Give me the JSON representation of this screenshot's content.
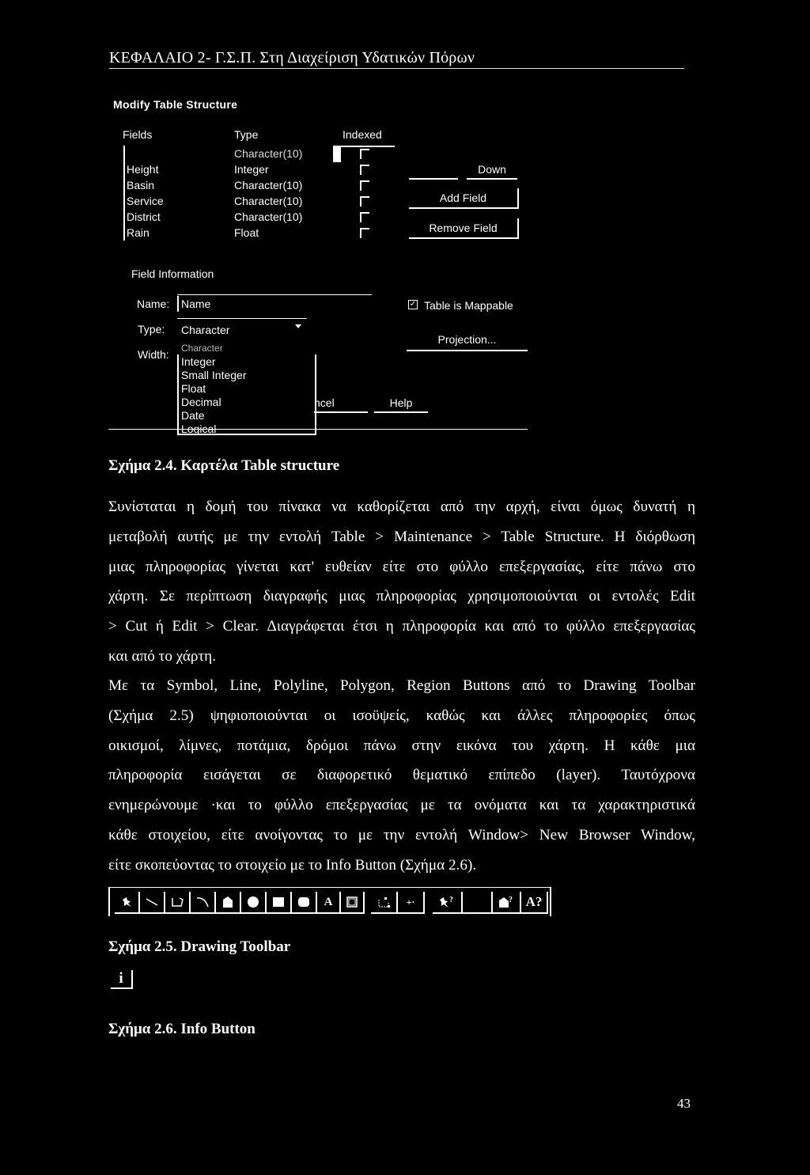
{
  "header": {
    "title": "ΚΕΦΑΛΑΙΟ 2- Γ.Σ.Π. Στη Διαχείριση Υδατικών Πόρων"
  },
  "dialog": {
    "title": "Modify Table Structure",
    "columns": {
      "fields": "Fields",
      "type": "Type",
      "indexed": "Indexed"
    },
    "rows": [
      {
        "field": "",
        "type": "Character(10)",
        "indexed": false
      },
      {
        "field": "Height",
        "type": "Integer",
        "indexed": false
      },
      {
        "field": "Basin",
        "type": "Character(10)",
        "indexed": false
      },
      {
        "field": "Service",
        "type": "Character(10)",
        "indexed": false
      },
      {
        "field": "District",
        "type": "Character(10)",
        "indexed": false
      },
      {
        "field": "Rain",
        "type": "Float",
        "indexed": false
      }
    ],
    "buttons": {
      "down": "Down",
      "add_field": "Add Field",
      "remove_field": "Remove Field",
      "projection": "Projection...",
      "cancel_partial": "ncel",
      "help": "Help"
    },
    "field_info": {
      "label": "Field Information",
      "name_label": "Name:",
      "name_value": "Name",
      "type_label": "Type:",
      "type_value": "Character",
      "width_label": "Width:",
      "type_options": [
        "Character",
        "Integer",
        "Small Integer",
        "Float",
        "Decimal",
        "Date",
        "Logical"
      ],
      "mappable_label": "Table is Mappable",
      "mappable_checked": true,
      "mappable_mark": "✓"
    }
  },
  "document": {
    "caption_2_4": "Σχήμα 2.4. Καρτέλα Table structure",
    "para1": [
      "Συνίσταται η δομή του πίνακα να καθορίζεται από την αρχή, είναι όμως δυνατή η",
      "μεταβολή αυτής με την εντολή Table > Maintenance > Table Structure. Η διόρθωση",
      "μιας πληροφορίας γίνεται κατ' ευθείαν είτε στο φύλλο επεξεργασίας, είτε πάνω στο",
      "χάρτη. Σε περίπτωση διαγραφής μιας πληροφορίας χρησιμοποιούνται οι εντολές Edit",
      "> Cut ή Edit > Clear. Διαγράφεται έτσι η πληροφορία και από το φύλλο επεξεργασίας",
      "και από το χάρτη."
    ],
    "para2": [
      "Με τα Symbol, Line, Polyline, Polygon, Region Buttons από το Drawing Toolbar",
      "(Σχήμα 2.5)  ψηφιοποιούνται οι ισοϋψείς, καθώς και άλλες πληροφορίες όπως",
      "οικισμοί, λίμνες, ποτάμια, δρόμοι πάνω στην εικόνα του χάρτη. Η κάθε μια",
      "πληροφορία εισάγεται σε διαφορετικό θεματικό επίπεδο (layer). Ταυτόχρονα",
      "ενημερώνουμε ·και το φύλλο επεξεργασίας με τα ονόματα και τα χαρακτηριστικά",
      "κάθε στοιχείου, είτε ανοίγοντας το με την εντολή Window> New Browser Window,",
      "είτε σκοπεύοντας το στοιχείο με το Info Button (Σχήμα 2.6)."
    ],
    "caption_2_5": "Σχήμα 2.5. Drawing Toolbar",
    "caption_2_6": "Σχήμα 2.6. Info Button",
    "page_number": "43"
  },
  "toolbar": {
    "buttons": [
      {
        "icon": "symbol-pin-icon",
        "glyph": "✎"
      },
      {
        "icon": "line-icon",
        "glyph": ""
      },
      {
        "icon": "polyline-icon",
        "glyph": ""
      },
      {
        "icon": "arc-icon",
        "glyph": ""
      },
      {
        "icon": "polygon-icon",
        "glyph": ""
      },
      {
        "icon": "ellipse-icon",
        "glyph": ""
      },
      {
        "icon": "rectangle-icon",
        "glyph": ""
      },
      {
        "icon": "rounded-rectangle-icon",
        "glyph": ""
      },
      {
        "icon": "text-icon",
        "glyph": "A"
      },
      {
        "icon": "frame-icon",
        "glyph": ""
      },
      {
        "icon": "reshape-icon",
        "glyph": ""
      },
      {
        "icon": "add-node-icon",
        "glyph": "+·"
      },
      {
        "icon": "symbol-style-icon",
        "glyph": "?"
      },
      {
        "icon": "line-style-icon",
        "glyph": ""
      },
      {
        "icon": "region-style-icon",
        "glyph": "?"
      },
      {
        "icon": "text-style-icon",
        "glyph": "A?"
      }
    ],
    "info_glyph": "i"
  }
}
